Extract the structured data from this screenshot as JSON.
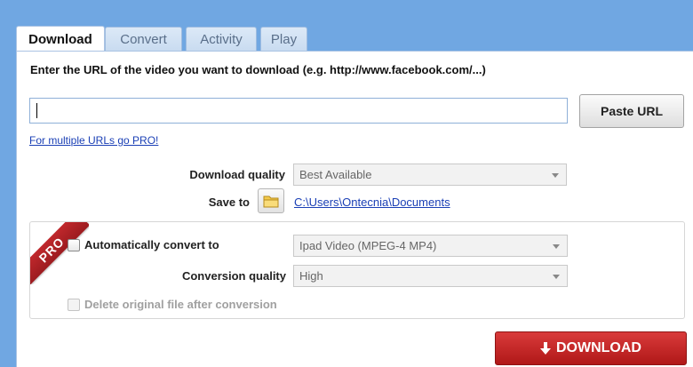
{
  "tabs": [
    {
      "label": "Download",
      "active": true
    },
    {
      "label": "Convert",
      "active": false
    },
    {
      "label": "Activity",
      "active": false
    },
    {
      "label": "Play",
      "active": false
    }
  ],
  "download": {
    "instructions": "Enter the URL of the video you want to download (e.g. http://www.facebook.com/...)",
    "url_value": "",
    "paste_button": "Paste URL",
    "pro_link": "For multiple URLs go PRO!",
    "quality_label": "Download quality",
    "quality_value": "Best Available",
    "save_label": "Save to",
    "save_path": "C:\\Users\\Ontecnia\\Documents",
    "folder_icon": "folder-icon"
  },
  "pro_section": {
    "ribbon": "PRO",
    "auto_convert_label": "Automatically convert to",
    "auto_convert_checked": false,
    "format_value": "Ipad Video (MPEG-4 MP4)",
    "conversion_quality_label": "Conversion quality",
    "conversion_quality_value": "High",
    "delete_label": "Delete original file after conversion",
    "delete_checked": false
  },
  "download_button": {
    "label": "DOWNLOAD",
    "icon": "arrow-down-icon"
  },
  "colors": {
    "window_bg": "#70a7e2",
    "link": "#1a3fb5",
    "download_red": "#c42828",
    "ribbon_red": "#b22226"
  }
}
